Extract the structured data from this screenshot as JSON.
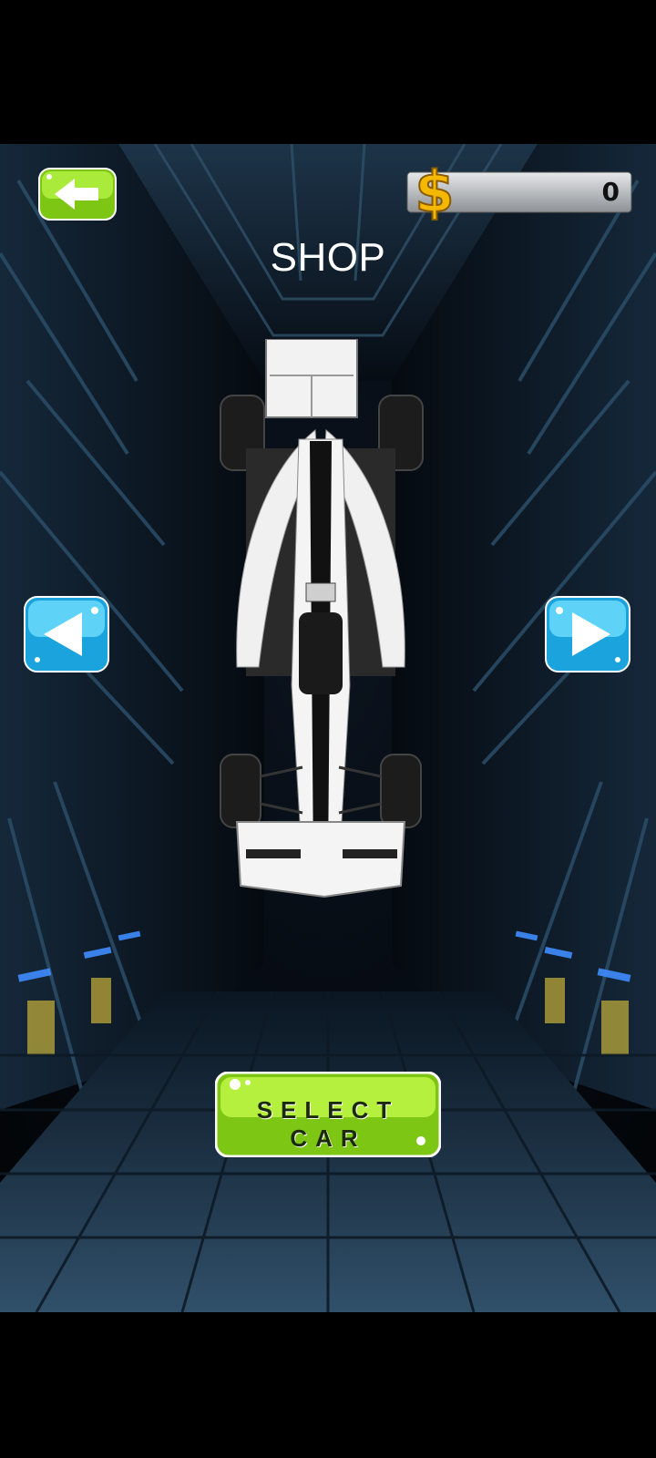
{
  "screen": {
    "title": "SHOP"
  },
  "wallet": {
    "coins": "0",
    "icon": "dollar-coin-icon"
  },
  "buttons": {
    "back_icon": "back-arrow-icon",
    "prev_icon": "left-triangle-icon",
    "next_icon": "right-triangle-icon",
    "select_label": "SELECT CAR"
  },
  "car": {
    "type": "formula-race-car",
    "color": "#f2f2f2",
    "accent": "#111111"
  },
  "colors": {
    "green_button": "#8fdc1a",
    "blue_button": "#29b6ea",
    "coin_gold": "#f5b800",
    "coin_bar": "#b9bcc0"
  }
}
